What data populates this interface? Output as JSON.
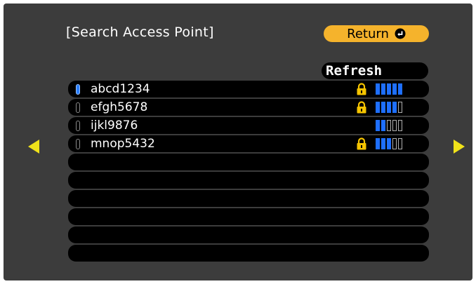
{
  "title": "[Search Access Point]",
  "return_button": {
    "label": "Return"
  },
  "refresh_button": {
    "label": "Refresh"
  },
  "access_points": [
    {
      "ssid": "abcd1234",
      "selected": true,
      "secured": true,
      "signal_bars": 5
    },
    {
      "ssid": "efgh5678",
      "selected": false,
      "secured": true,
      "signal_bars": 4
    },
    {
      "ssid": "ijkl9876",
      "selected": false,
      "secured": false,
      "signal_bars": 2
    },
    {
      "ssid": "mnop5432",
      "selected": false,
      "secured": true,
      "signal_bars": 3
    }
  ],
  "empty_rows": 6,
  "max_signal_bars": 5,
  "colors": {
    "background": "#3c3c3c",
    "accent_button": "#f5b32c",
    "signal": "#1e6fff",
    "lock": "#f5c400",
    "nav_arrow": "#f0e21a"
  },
  "icons": {
    "return": "return-arrow-circle-icon",
    "lock": "padlock-icon",
    "prev": "triangle-left-icon",
    "next": "triangle-right-icon"
  }
}
